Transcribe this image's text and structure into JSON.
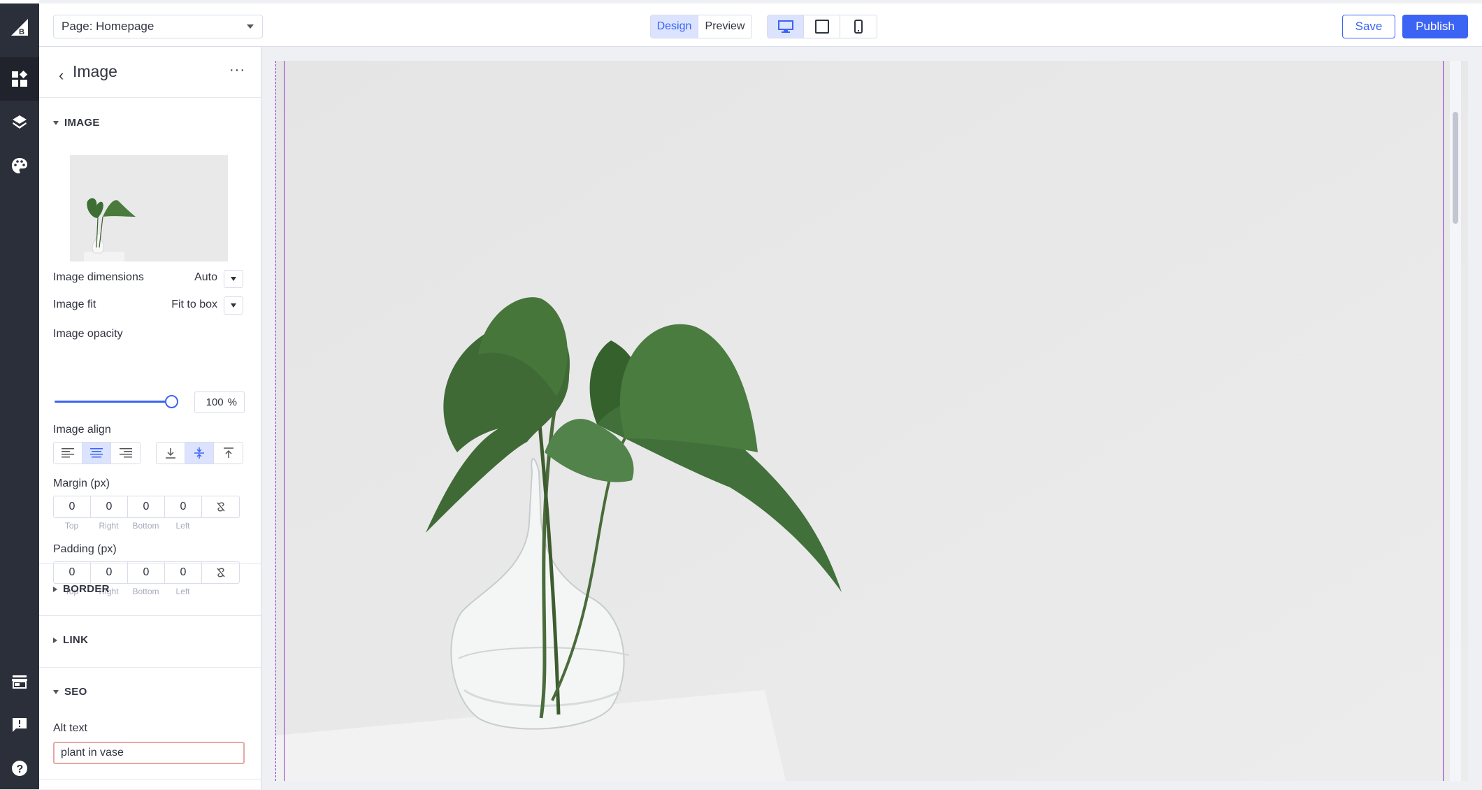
{
  "topbar": {
    "page_select": "Page: Homepage",
    "mode_design": "Design",
    "mode_preview": "Preview",
    "save": "Save",
    "publish": "Publish"
  },
  "panel": {
    "title": "Image",
    "sections": {
      "image": "IMAGE",
      "border": "BORDER",
      "link": "LINK",
      "seo": "SEO"
    },
    "image_dimensions": {
      "label": "Image dimensions",
      "value": "Auto"
    },
    "image_fit": {
      "label": "Image fit",
      "value": "Fit to box"
    },
    "image_opacity": {
      "label": "Image opacity",
      "value": "100",
      "unit": "%",
      "level": 1.0
    },
    "image_align": {
      "label": "Image align",
      "horizontal_selected": "center",
      "vertical_selected": "middle"
    },
    "margin": {
      "label": "Margin (px)",
      "values": [
        "0",
        "0",
        "0",
        "0"
      ],
      "sides": [
        "Top",
        "Right",
        "Bottom",
        "Left"
      ]
    },
    "padding": {
      "label": "Padding (px)",
      "values": [
        "0",
        "0",
        "0",
        "0"
      ],
      "sides": [
        "Top",
        "Right",
        "Bottom",
        "Left"
      ]
    },
    "alt_text": {
      "label": "Alt text",
      "value": "plant in vase"
    }
  },
  "icons": {
    "rail": [
      "bigcommerce-logo-icon",
      "widgets-icon",
      "layers-icon",
      "palette-icon",
      "storefront-icon",
      "feedback-icon",
      "help-icon"
    ],
    "devices": [
      "desktop-icon",
      "tablet-icon",
      "mobile-icon"
    ]
  },
  "colors": {
    "accent": "#3c64f4",
    "rail": "#2b2f3a",
    "guide": "#8a38c9",
    "error_border": "#e7a8a2"
  }
}
